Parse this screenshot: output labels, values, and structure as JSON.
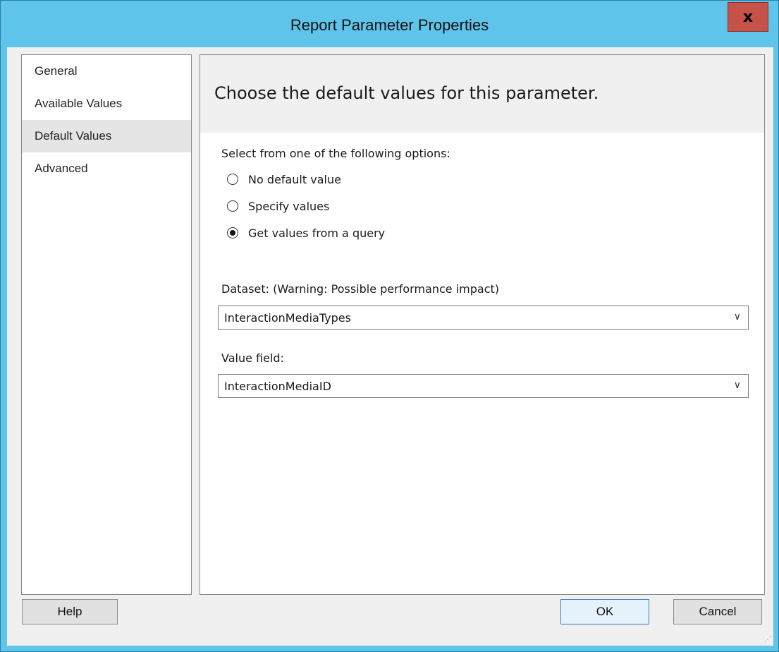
{
  "window": {
    "title": "Report Parameter Properties",
    "close_label": "x"
  },
  "sidebar": {
    "items": [
      {
        "label": "General",
        "active": false
      },
      {
        "label": "Available Values",
        "active": false
      },
      {
        "label": "Default Values",
        "active": true
      },
      {
        "label": "Advanced",
        "active": false
      }
    ]
  },
  "main": {
    "header": "Choose the default values for this parameter.",
    "options_label": "Select from one of the following options:",
    "options": [
      {
        "label": "No default value",
        "selected": false
      },
      {
        "label": "Specify values",
        "selected": false
      },
      {
        "label": "Get values from a query",
        "selected": true
      }
    ],
    "dataset_label": "Dataset: (Warning: Possible performance impact)",
    "dataset_value": "InteractionMediaTypes",
    "value_field_label": "Value field:",
    "value_field_value": "InteractionMediaID"
  },
  "footer": {
    "help_label": "Help",
    "ok_label": "OK",
    "cancel_label": "Cancel"
  },
  "colors": {
    "title_bar": "#5ec4ea",
    "close_button": "#c7524a",
    "dialog_background": "#f0f0f0",
    "selected_nav": "#e5e5e5"
  }
}
